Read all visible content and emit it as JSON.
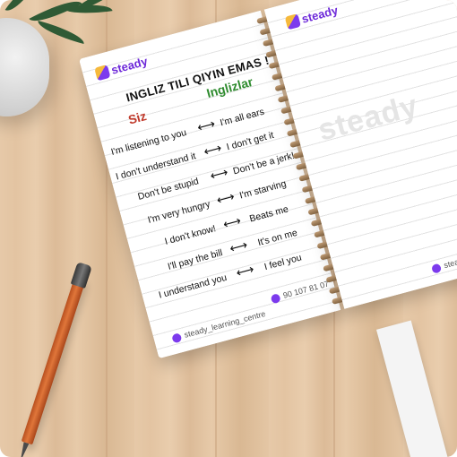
{
  "brand": {
    "logo": "steady",
    "handle": "steady_learning_centre",
    "phone": "90 107 81 07",
    "watermark": "steady"
  },
  "worksheet": {
    "title": "INGLIZ TILI QIYIN EMAS !",
    "col_left": "Siz",
    "col_right": "Inglizlar",
    "pairs": [
      {
        "left": "I'm listening to you",
        "right": "I'm all ears"
      },
      {
        "left": "I don't understand it",
        "right": "I don't get it"
      },
      {
        "left": "Don't be stupid",
        "right": "Don't be a jerk!"
      },
      {
        "left": "I'm very hungry",
        "right": "I'm starving"
      },
      {
        "left": "I don't know!",
        "right": "Beats me"
      },
      {
        "left": "I'll pay the bill",
        "right": "It's on me"
      },
      {
        "left": "I understand you",
        "right": "I feel you"
      }
    ],
    "arrow": "⟷"
  },
  "colors": {
    "brand_purple": "#6d28d9",
    "siz_red": "#c0392b",
    "ingliz_green": "#2e8b2e"
  }
}
